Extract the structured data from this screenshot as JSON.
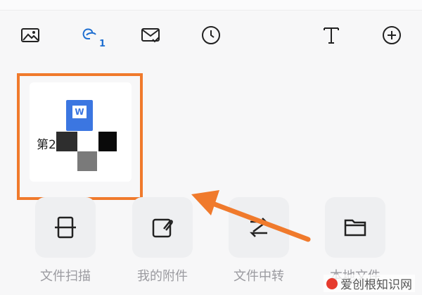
{
  "toolbar": {
    "items": [
      {
        "icon": "image-icon"
      },
      {
        "icon": "link-icon",
        "badge": "1"
      },
      {
        "icon": "mail-check-icon"
      },
      {
        "icon": "clock-icon"
      },
      {
        "icon": "text-icon"
      },
      {
        "icon": "add-circle-icon"
      }
    ]
  },
  "file_card": {
    "icon": "word-document-icon",
    "icon_letter": "W",
    "name": "第2"
  },
  "actions": [
    {
      "label": "文件扫描",
      "icon": "scan-icon"
    },
    {
      "label": "我的附件",
      "icon": "attachment-icon"
    },
    {
      "label": "文件中转",
      "icon": "transfer-icon"
    },
    {
      "label": "本地文件",
      "icon": "folder-icon"
    }
  ],
  "watermark": {
    "text": "爱创根知识网"
  },
  "colors": {
    "highlight": "#f07a2c",
    "accent": "#1f6fd1",
    "word": "#3b76e1"
  }
}
